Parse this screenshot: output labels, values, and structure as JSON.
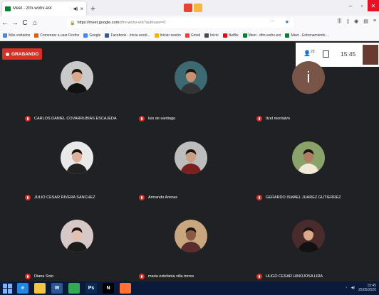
{
  "browser": {
    "tab": {
      "title": "Meet - zfm-wohv-eot",
      "icon": "meet-icon"
    },
    "new_tab_glyph": "+",
    "window_controls": {
      "minimize": "–",
      "maximize": "▫",
      "close": "✕"
    },
    "url": {
      "host": "https://meet.google.com",
      "path": "/zfm-wohv-eot?authuser=0"
    },
    "nav": {
      "back": "←",
      "forward": "→",
      "reload": "C",
      "home": "⌂"
    },
    "bookmarks": [
      {
        "label": "Más visitados",
        "icon_color": "#4a88da"
      },
      {
        "label": "Comenzar a usar Firefox",
        "icon_color": "#e66000"
      },
      {
        "label": "Google",
        "icon_color": "#4285f4"
      },
      {
        "label": "Facebook - Inicia sesió...",
        "icon_color": "#3b5998"
      },
      {
        "label": "Iniciar sesión",
        "icon_color": "#f4b400"
      },
      {
        "label": "Gmail",
        "icon_color": "#ea4335"
      },
      {
        "label": "Inicio",
        "icon_color": "#4a4a4a"
      },
      {
        "label": "Netflix",
        "icon_color": "#e50914"
      },
      {
        "label": "Meet - dfm-wohv-eot",
        "icon_color": "#00832d"
      },
      {
        "label": "Meet - Entrenamiento ...",
        "icon_color": "#00832d"
      }
    ]
  },
  "meet": {
    "recording_label": "GRABANDO",
    "participant_count": "20",
    "time": "15:45",
    "colors": {
      "bg": "#202124",
      "mic_off": "#d93025"
    },
    "participants": [
      {
        "name": "CARLOS DANIEL COVARRUBIAS ESCAJEDA",
        "avatar": "photo",
        "bg": "#c9c9c9"
      },
      {
        "name": "luis de santiago",
        "avatar": "photo",
        "bg": "#3d6a72"
      },
      {
        "name": "Itzel montalvo",
        "avatar": "letter",
        "letter": "i",
        "bg": "#795548"
      },
      {
        "name": "JULIO CESAR RIVERA SANCHEZ",
        "avatar": "photo",
        "bg": "#e9e9e9"
      },
      {
        "name": "Armando Arenas",
        "avatar": "photo",
        "bg": "#bdbdbd"
      },
      {
        "name": "GERARDO ISMAEL JUAREZ GUTIERREZ",
        "avatar": "photo",
        "bg": "#8aa36a"
      },
      {
        "name": "Diana Soto",
        "avatar": "photo",
        "bg": "#d7c8c8"
      },
      {
        "name": "maria estefania villa torres",
        "avatar": "photo",
        "bg": "#c9a77e"
      },
      {
        "name": "HUGO CESAR HINOJOSA LIRA",
        "avatar": "photo",
        "bg": "#4a2b2b"
      }
    ]
  },
  "taskbar": {
    "apps": [
      {
        "name": "edge",
        "color": "#1e88e5",
        "glyph": "e"
      },
      {
        "name": "files",
        "color": "#f4c542",
        "glyph": ""
      },
      {
        "name": "word",
        "color": "#2b579a",
        "glyph": "W"
      },
      {
        "name": "chrome",
        "color": "#34a853",
        "glyph": ""
      },
      {
        "name": "photoshop",
        "color": "#0a2a56",
        "glyph": "Ps"
      },
      {
        "name": "netflix",
        "color": "#000000",
        "glyph": "N"
      },
      {
        "name": "firefox",
        "color": "#ff7139",
        "glyph": ""
      }
    ],
    "clock": "15:45",
    "date": "25/05/2020"
  }
}
